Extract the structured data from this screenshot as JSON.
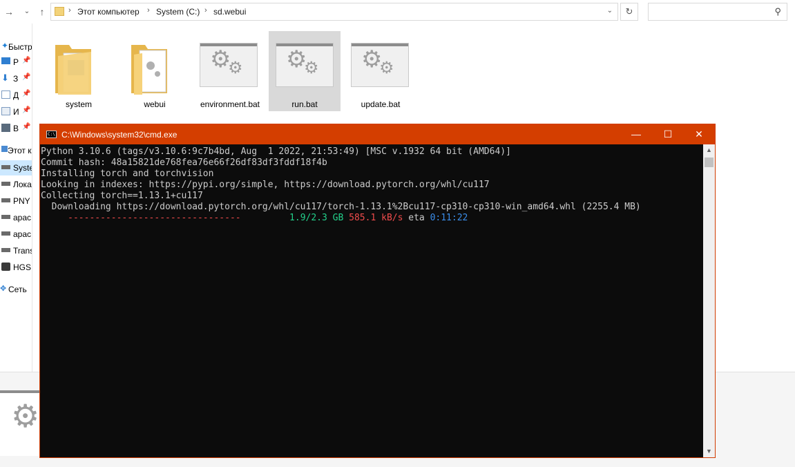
{
  "explorer": {
    "breadcrumbs": [
      "Этот компьютер",
      "System (C:)",
      "sd.webui"
    ],
    "search_placeholder": "",
    "sidebar": [
      {
        "label": "Быстр",
        "icon": "star-icon"
      },
      {
        "label": "Р",
        "icon": "desktop-icon",
        "pinned": true
      },
      {
        "label": "З",
        "icon": "download-icon",
        "pinned": true
      },
      {
        "label": "Д",
        "icon": "documents-icon",
        "pinned": true
      },
      {
        "label": "И",
        "icon": "images-icon",
        "pinned": true
      },
      {
        "label": "В",
        "icon": "videos-icon",
        "pinned": true
      },
      {
        "label": "Этот к",
        "icon": "computer-icon"
      },
      {
        "label": "Syste",
        "icon": "drive-icon",
        "selected": true
      },
      {
        "label": "Лока",
        "icon": "drive-icon"
      },
      {
        "label": "PNY",
        "icon": "drive-icon"
      },
      {
        "label": "apac",
        "icon": "drive-icon"
      },
      {
        "label": "apac",
        "icon": "drive-icon"
      },
      {
        "label": "Trans",
        "icon": "drive-icon"
      },
      {
        "label": "HGS",
        "icon": "drive-icon"
      },
      {
        "label": "Сеть",
        "icon": "network-icon"
      }
    ],
    "files": [
      {
        "name": "system",
        "type": "folder"
      },
      {
        "name": "webui",
        "type": "folder"
      },
      {
        "name": "environment.bat",
        "type": "bat"
      },
      {
        "name": "run.bat",
        "type": "bat",
        "selected": true
      },
      {
        "name": "update.bat",
        "type": "bat"
      }
    ]
  },
  "cmd": {
    "title": "C:\\Windows\\system32\\cmd.exe",
    "icon_text": "C:\\",
    "controls": {
      "minimize": "—",
      "maximize": "☐",
      "close": "✕"
    },
    "lines": [
      "Python 3.10.6 (tags/v3.10.6:9c7b4bd, Aug  1 2022, 21:53:49) [MSC v.1932 64 bit (AMD64)]",
      "Commit hash: 48a15821de768fea76e66f26df83df3fddf18f4b",
      "Installing torch and torchvision",
      "Looking in indexes: https://pypi.org/simple, https://download.pytorch.org/whl/cu117",
      "Collecting torch==1.13.1+cu117",
      "  Downloading https://download.pytorch.org/whl/cu117/torch-1.13.1%2Bcu117-cp310-cp310-win_amd64.whl (2255.4 MB)"
    ],
    "progress": {
      "bar": "--------------------------------",
      "size": "1.9/2.3 GB",
      "speed": "585.1 kB/s",
      "eta_label": "eta",
      "eta": "0:11:22"
    }
  },
  "colors": {
    "titlebar": "#d43e00",
    "progress_bar": "#f14c4c",
    "size": "#23d18b",
    "speed": "#f14c4c",
    "eta": "#3b8eea"
  }
}
